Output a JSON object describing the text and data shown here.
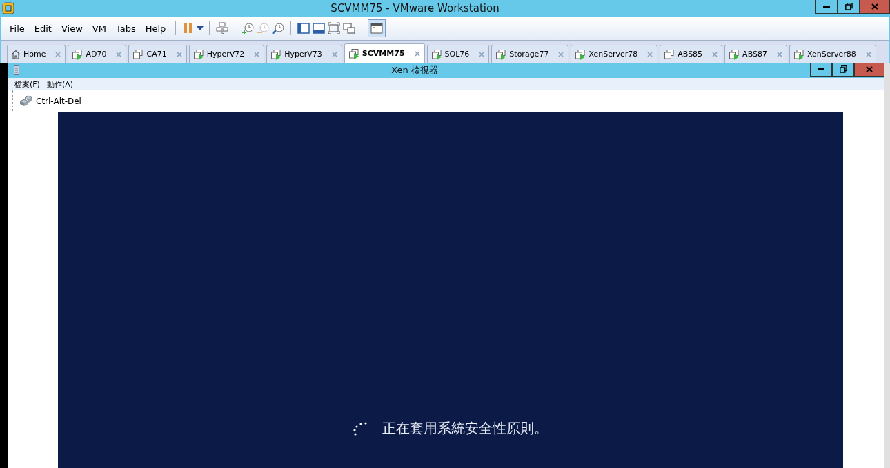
{
  "window": {
    "title": "SCVMM75 - VMware Workstation"
  },
  "menu": [
    "File",
    "Edit",
    "View",
    "VM",
    "Tabs",
    "Help"
  ],
  "tabs": [
    {
      "label": "Home",
      "kind": "home",
      "running": false,
      "selected": false
    },
    {
      "label": "AD70",
      "kind": "vm",
      "running": true,
      "selected": false
    },
    {
      "label": "CA71",
      "kind": "vm",
      "running": false,
      "selected": false
    },
    {
      "label": "HyperV72",
      "kind": "vm",
      "running": true,
      "selected": false
    },
    {
      "label": "HyperV73",
      "kind": "vm",
      "running": true,
      "selected": false
    },
    {
      "label": "SCVMM75",
      "kind": "vm",
      "running": true,
      "selected": true
    },
    {
      "label": "SQL76",
      "kind": "vm",
      "running": true,
      "selected": false
    },
    {
      "label": "Storage77",
      "kind": "vm",
      "running": true,
      "selected": false
    },
    {
      "label": "XenServer78",
      "kind": "vm",
      "running": true,
      "selected": false
    },
    {
      "label": "ABS85",
      "kind": "vm",
      "running": false,
      "selected": false
    },
    {
      "label": "ABS87",
      "kind": "vm",
      "running": true,
      "selected": false
    },
    {
      "label": "XenServer88",
      "kind": "vm",
      "running": true,
      "selected": false
    }
  ],
  "guest": {
    "title": "Xen 檢視器",
    "menu": [
      "檔案(F)",
      "動作(A)"
    ],
    "toolbar_button": "Ctrl-Alt-Del",
    "screen_message": "正在套用系統安全性原則。"
  }
}
